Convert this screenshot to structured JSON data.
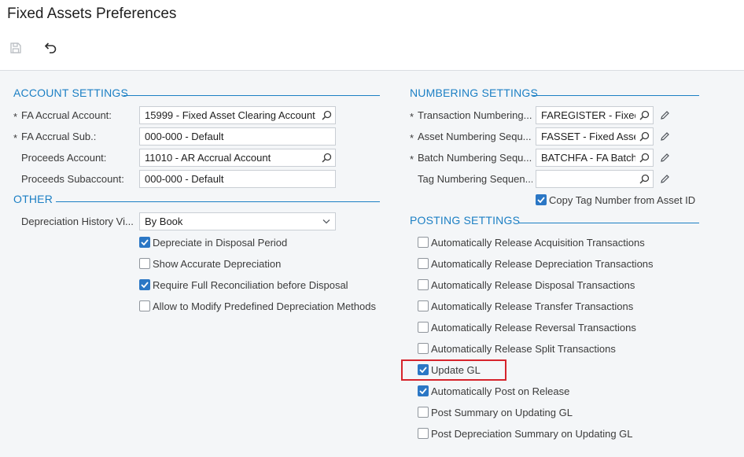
{
  "header": {
    "title": "Fixed Assets Preferences",
    "save_icon": "save-icon",
    "undo_icon": "undo-icon"
  },
  "account_settings": {
    "title": "ACCOUNT SETTINGS",
    "fields": [
      {
        "label": "FA Accrual Account:",
        "value": "15999 - Fixed Asset Clearing Account",
        "required": true
      },
      {
        "label": "FA Accrual Sub.:",
        "value": "000-000 - Default",
        "required": true
      },
      {
        "label": "Proceeds Account:",
        "value": "11010 - AR Accrual Account",
        "required": false
      },
      {
        "label": "Proceeds Subaccount:",
        "value": "000-000 - Default",
        "required": false
      }
    ]
  },
  "other": {
    "title": "OTHER",
    "depreciation_history": {
      "label": "Depreciation History Vi...",
      "value": "By Book"
    },
    "checkboxes": [
      {
        "label": "Depreciate in Disposal Period",
        "checked": true
      },
      {
        "label": "Show Accurate Depreciation",
        "checked": false
      },
      {
        "label": "Require Full Reconciliation before Disposal",
        "checked": true
      },
      {
        "label": "Allow to Modify Predefined Depreciation Methods",
        "checked": false
      }
    ]
  },
  "numbering_settings": {
    "title": "NUMBERING SETTINGS",
    "fields": [
      {
        "label": "Transaction Numbering...",
        "value": "FAREGISTER - Fixed",
        "required": true
      },
      {
        "label": "Asset Numbering Sequ...",
        "value": "FASSET - Fixed Asse",
        "required": true
      },
      {
        "label": "Batch Numbering Sequ...",
        "value": "BATCHFA - FA Batch",
        "required": true
      },
      {
        "label": "Tag Numbering Sequen...",
        "value": "",
        "required": false
      }
    ],
    "copy_tag": {
      "label": "Copy Tag Number from Asset ID",
      "checked": true
    }
  },
  "posting_settings": {
    "title": "POSTING SETTINGS",
    "checkboxes": [
      {
        "label": "Automatically Release Acquisition Transactions",
        "checked": false
      },
      {
        "label": "Automatically Release Depreciation Transactions",
        "checked": false
      },
      {
        "label": "Automatically Release Disposal Transactions",
        "checked": false
      },
      {
        "label": "Automatically Release Transfer Transactions",
        "checked": false
      },
      {
        "label": "Automatically Release Reversal Transactions",
        "checked": false
      },
      {
        "label": "Automatically Release Split Transactions",
        "checked": false
      },
      {
        "label": "Update GL",
        "checked": true
      },
      {
        "label": "Automatically Post on Release",
        "checked": true
      },
      {
        "label": "Post Summary on Updating GL",
        "checked": false
      },
      {
        "label": "Post Depreciation Summary on Updating GL",
        "checked": false
      }
    ]
  },
  "colors": {
    "accent": "#1b7fc4",
    "checkbox_checked": "#2b77c5",
    "highlight": "#d6242c"
  }
}
